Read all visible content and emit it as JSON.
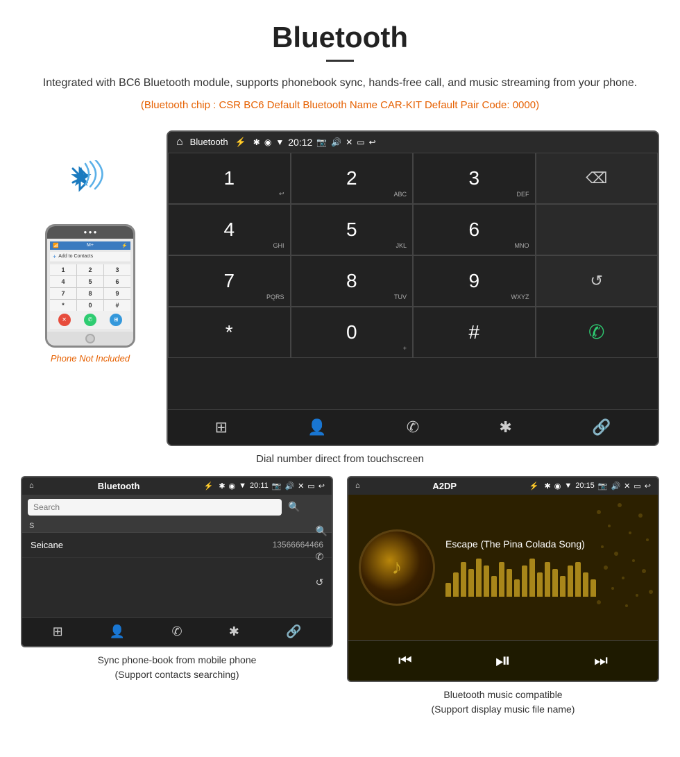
{
  "header": {
    "title": "Bluetooth",
    "divider": true,
    "description": "Integrated with BC6 Bluetooth module, supports phonebook sync, hands-free call, and music streaming from your phone.",
    "specs": "(Bluetooth chip : CSR BC6    Default Bluetooth Name CAR-KIT    Default Pair Code: 0000)"
  },
  "phone_label": "Phone Not Included",
  "car_screen_large": {
    "status_bar": {
      "app_name": "Bluetooth",
      "time": "20:12"
    },
    "dialpad": {
      "keys": [
        {
          "main": "1",
          "sub": ""
        },
        {
          "main": "2",
          "sub": "ABC"
        },
        {
          "main": "3",
          "sub": "DEF"
        },
        {
          "main": "",
          "sub": ""
        },
        {
          "main": "4",
          "sub": "GHI"
        },
        {
          "main": "5",
          "sub": "JKL"
        },
        {
          "main": "6",
          "sub": "MNO"
        },
        {
          "main": "",
          "sub": ""
        },
        {
          "main": "7",
          "sub": "PQRS"
        },
        {
          "main": "8",
          "sub": "TUV"
        },
        {
          "main": "9",
          "sub": "WXYZ"
        },
        {
          "main": "↺",
          "sub": ""
        },
        {
          "main": "*",
          "sub": ""
        },
        {
          "main": "0+",
          "sub": ""
        },
        {
          "main": "#",
          "sub": ""
        },
        {
          "main": "✆",
          "sub": ""
        }
      ]
    },
    "bottom_nav": [
      "⊞",
      "👤",
      "✆",
      "✱",
      "🔗"
    ]
  },
  "large_caption": "Dial number direct from touchscreen",
  "phonebook_screen": {
    "status_bar": {
      "app_name": "Bluetooth",
      "time": "20:11"
    },
    "search_placeholder": "Search",
    "contacts": [
      {
        "letter": "S",
        "name": "Seicane",
        "phone": "13566664466"
      }
    ],
    "bottom_nav": [
      "⊞",
      "👤",
      "✆",
      "✱",
      "🔗"
    ]
  },
  "phonebook_caption_line1": "Sync phone-book from mobile phone",
  "phonebook_caption_line2": "(Support contacts searching)",
  "music_screen": {
    "status_bar": {
      "app_name": "A2DP",
      "time": "20:15"
    },
    "song_title": "Escape (The Pina Colada Song)",
    "controls": [
      "⏮",
      "⏯",
      "⏭"
    ]
  },
  "music_caption_line1": "Bluetooth music compatible",
  "music_caption_line2": "(Support display music file name)",
  "visualizer_heights": [
    20,
    35,
    50,
    40,
    55,
    45,
    30,
    50,
    40,
    25,
    45,
    55,
    35,
    50,
    40,
    30,
    45,
    50,
    35,
    25
  ]
}
